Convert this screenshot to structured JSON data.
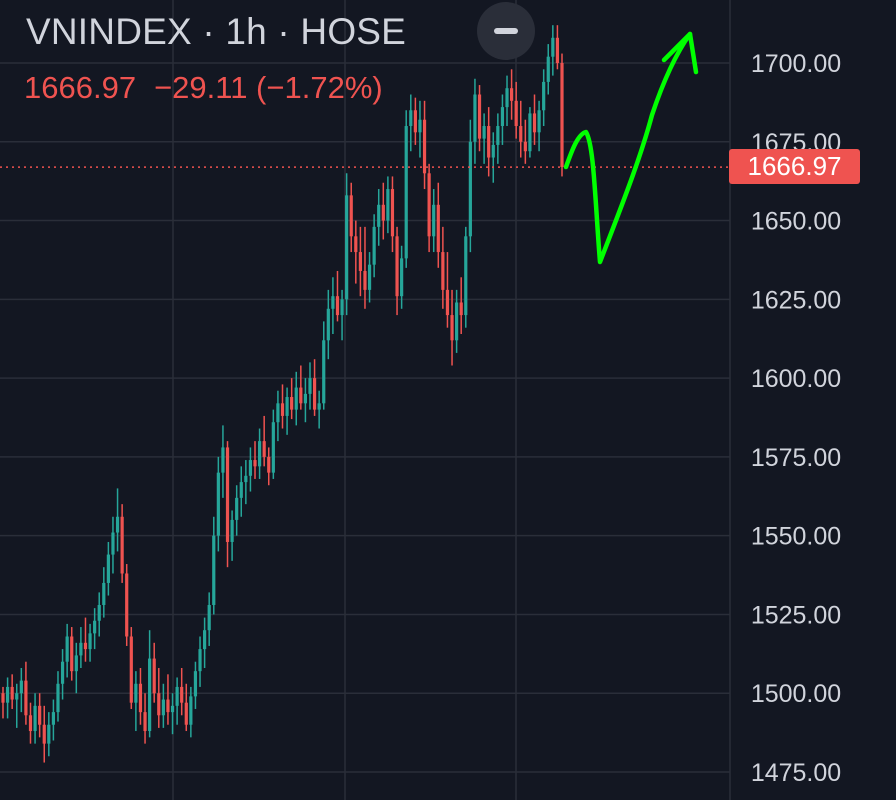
{
  "header": {
    "title": "VNINDEX · 1h · HOSE",
    "last_price": "1666.97",
    "change": "−29.11 (−1.72%)",
    "collapse_icon": "minus-icon"
  },
  "price_tag": "1666.97",
  "colors": {
    "background": "#131722",
    "up": "#26a69a",
    "down": "#ef5350",
    "grid": "#2a2e39",
    "text": "#d1d4dc",
    "drawing": "#00ff00"
  },
  "chart_data": {
    "type": "candlestick",
    "symbol": "VNINDEX",
    "interval": "1h",
    "exchange": "HOSE",
    "ylim": [
      1470,
      1720
    ],
    "y_ticks": [
      "1475.00",
      "1500.00",
      "1525.00",
      "1550.00",
      "1575.00",
      "1600.00",
      "1625.00",
      "1650.00",
      "1675.00",
      "1700.00"
    ],
    "last_price": 1666.97,
    "series": [
      {
        "values": [
          [
            1500,
            1502,
            1492,
            1497
          ],
          [
            1497,
            1505,
            1492,
            1502
          ],
          [
            1502,
            1506,
            1495,
            1498
          ],
          [
            1498,
            1503,
            1489,
            1500
          ],
          [
            1500,
            1508,
            1494,
            1504
          ],
          [
            1504,
            1510,
            1490,
            1493
          ],
          [
            1493,
            1497,
            1484,
            1488
          ],
          [
            1488,
            1500,
            1484,
            1496
          ],
          [
            1496,
            1500,
            1486,
            1490
          ],
          [
            1490,
            1496,
            1478,
            1484
          ],
          [
            1484,
            1494,
            1480,
            1490
          ],
          [
            1490,
            1498,
            1485,
            1494
          ],
          [
            1494,
            1507,
            1491,
            1503
          ],
          [
            1503,
            1514,
            1498,
            1510
          ],
          [
            1510,
            1522,
            1505,
            1518
          ],
          [
            1518,
            1521,
            1504,
            1507
          ],
          [
            1507,
            1516,
            1500,
            1512
          ],
          [
            1512,
            1521,
            1508,
            1516
          ],
          [
            1516,
            1524,
            1510,
            1514
          ],
          [
            1514,
            1522,
            1510,
            1519
          ],
          [
            1519,
            1527,
            1514,
            1523
          ],
          [
            1523,
            1532,
            1518,
            1528
          ],
          [
            1528,
            1540,
            1524,
            1535
          ],
          [
            1535,
            1548,
            1531,
            1544
          ],
          [
            1544,
            1556,
            1538,
            1551
          ],
          [
            1551,
            1565,
            1545,
            1556
          ],
          [
            1556,
            1560,
            1535,
            1538
          ],
          [
            1538,
            1541,
            1515,
            1518
          ],
          [
            1518,
            1521,
            1495,
            1497
          ],
          [
            1497,
            1507,
            1488,
            1503
          ],
          [
            1503,
            1508,
            1490,
            1494
          ],
          [
            1494,
            1500,
            1484,
            1488
          ],
          [
            1488,
            1520,
            1486,
            1511
          ],
          [
            1511,
            1516,
            1497,
            1500
          ],
          [
            1500,
            1508,
            1489,
            1493
          ],
          [
            1493,
            1503,
            1489,
            1498
          ],
          [
            1498,
            1506,
            1490,
            1494
          ],
          [
            1494,
            1500,
            1487,
            1496
          ],
          [
            1496,
            1505,
            1490,
            1502
          ],
          [
            1502,
            1508,
            1493,
            1497
          ],
          [
            1497,
            1503,
            1488,
            1490
          ],
          [
            1490,
            1502,
            1486,
            1499
          ],
          [
            1499,
            1510,
            1495,
            1507
          ],
          [
            1507,
            1518,
            1502,
            1514
          ],
          [
            1514,
            1524,
            1508,
            1520
          ],
          [
            1520,
            1532,
            1515,
            1528
          ],
          [
            1528,
            1556,
            1525,
            1550
          ],
          [
            1550,
            1575,
            1545,
            1570
          ],
          [
            1570,
            1585,
            1562,
            1578
          ],
          [
            1578,
            1580,
            1540,
            1548
          ],
          [
            1548,
            1558,
            1542,
            1555
          ],
          [
            1555,
            1566,
            1550,
            1562
          ],
          [
            1562,
            1572,
            1556,
            1567
          ],
          [
            1567,
            1574,
            1560,
            1569
          ],
          [
            1569,
            1578,
            1564,
            1574
          ],
          [
            1574,
            1580,
            1568,
            1572
          ],
          [
            1572,
            1584,
            1568,
            1580
          ],
          [
            1580,
            1588,
            1572,
            1575
          ],
          [
            1575,
            1578,
            1566,
            1570
          ],
          [
            1570,
            1590,
            1568,
            1586
          ],
          [
            1586,
            1596,
            1580,
            1592
          ],
          [
            1592,
            1598,
            1584,
            1588
          ],
          [
            1588,
            1597,
            1582,
            1594
          ],
          [
            1594,
            1600,
            1587,
            1590
          ],
          [
            1590,
            1602,
            1585,
            1597
          ],
          [
            1597,
            1604,
            1590,
            1592
          ],
          [
            1592,
            1600,
            1586,
            1595
          ],
          [
            1595,
            1605,
            1590,
            1600
          ],
          [
            1600,
            1606,
            1588,
            1590
          ],
          [
            1590,
            1596,
            1584,
            1592
          ],
          [
            1592,
            1618,
            1590,
            1612
          ],
          [
            1612,
            1628,
            1606,
            1622
          ],
          [
            1622,
            1632,
            1614,
            1626
          ],
          [
            1626,
            1634,
            1618,
            1620
          ],
          [
            1620,
            1628,
            1612,
            1625
          ],
          [
            1625,
            1665,
            1620,
            1658
          ],
          [
            1658,
            1662,
            1640,
            1645
          ],
          [
            1645,
            1650,
            1630,
            1640
          ],
          [
            1640,
            1648,
            1626,
            1634
          ],
          [
            1634,
            1648,
            1622,
            1628
          ],
          [
            1628,
            1640,
            1624,
            1636
          ],
          [
            1636,
            1652,
            1632,
            1648
          ],
          [
            1648,
            1660,
            1642,
            1655
          ],
          [
            1655,
            1662,
            1644,
            1650
          ],
          [
            1650,
            1664,
            1646,
            1660
          ],
          [
            1660,
            1664,
            1640,
            1645
          ],
          [
            1645,
            1648,
            1620,
            1626
          ],
          [
            1626,
            1642,
            1622,
            1638
          ],
          [
            1638,
            1685,
            1635,
            1680
          ],
          [
            1680,
            1690,
            1672,
            1685
          ],
          [
            1685,
            1689,
            1674,
            1678
          ],
          [
            1678,
            1688,
            1670,
            1682
          ],
          [
            1682,
            1688,
            1660,
            1665
          ],
          [
            1665,
            1668,
            1640,
            1645
          ],
          [
            1645,
            1660,
            1640,
            1655
          ],
          [
            1655,
            1662,
            1635,
            1640
          ],
          [
            1640,
            1648,
            1622,
            1628
          ],
          [
            1628,
            1640,
            1616,
            1620
          ],
          [
            1620,
            1628,
            1604,
            1612
          ],
          [
            1612,
            1628,
            1608,
            1624
          ],
          [
            1624,
            1632,
            1614,
            1620
          ],
          [
            1620,
            1648,
            1616,
            1645
          ],
          [
            1645,
            1682,
            1640,
            1675
          ],
          [
            1675,
            1695,
            1668,
            1690
          ],
          [
            1690,
            1693,
            1672,
            1676
          ],
          [
            1676,
            1684,
            1668,
            1680
          ],
          [
            1680,
            1686,
            1664,
            1670
          ],
          [
            1670,
            1678,
            1662,
            1674
          ],
          [
            1674,
            1684,
            1668,
            1680
          ],
          [
            1680,
            1690,
            1674,
            1686
          ],
          [
            1686,
            1696,
            1680,
            1692
          ],
          [
            1692,
            1698,
            1682,
            1688
          ],
          [
            1688,
            1694,
            1676,
            1680
          ],
          [
            1680,
            1688,
            1670,
            1675
          ],
          [
            1675,
            1682,
            1668,
            1672
          ],
          [
            1672,
            1686,
            1670,
            1684
          ],
          [
            1684,
            1690,
            1674,
            1678
          ],
          [
            1678,
            1688,
            1672,
            1685
          ],
          [
            1685,
            1698,
            1680,
            1694
          ],
          [
            1694,
            1706,
            1690,
            1702
          ],
          [
            1702,
            1712,
            1696,
            1708
          ],
          [
            1708,
            1712,
            1698,
            1700
          ],
          [
            1700,
            1703,
            1664,
            1667
          ]
        ]
      }
    ],
    "annotation": "green hand-drawn arrow: dip to ~1636, then rise above 1700"
  }
}
